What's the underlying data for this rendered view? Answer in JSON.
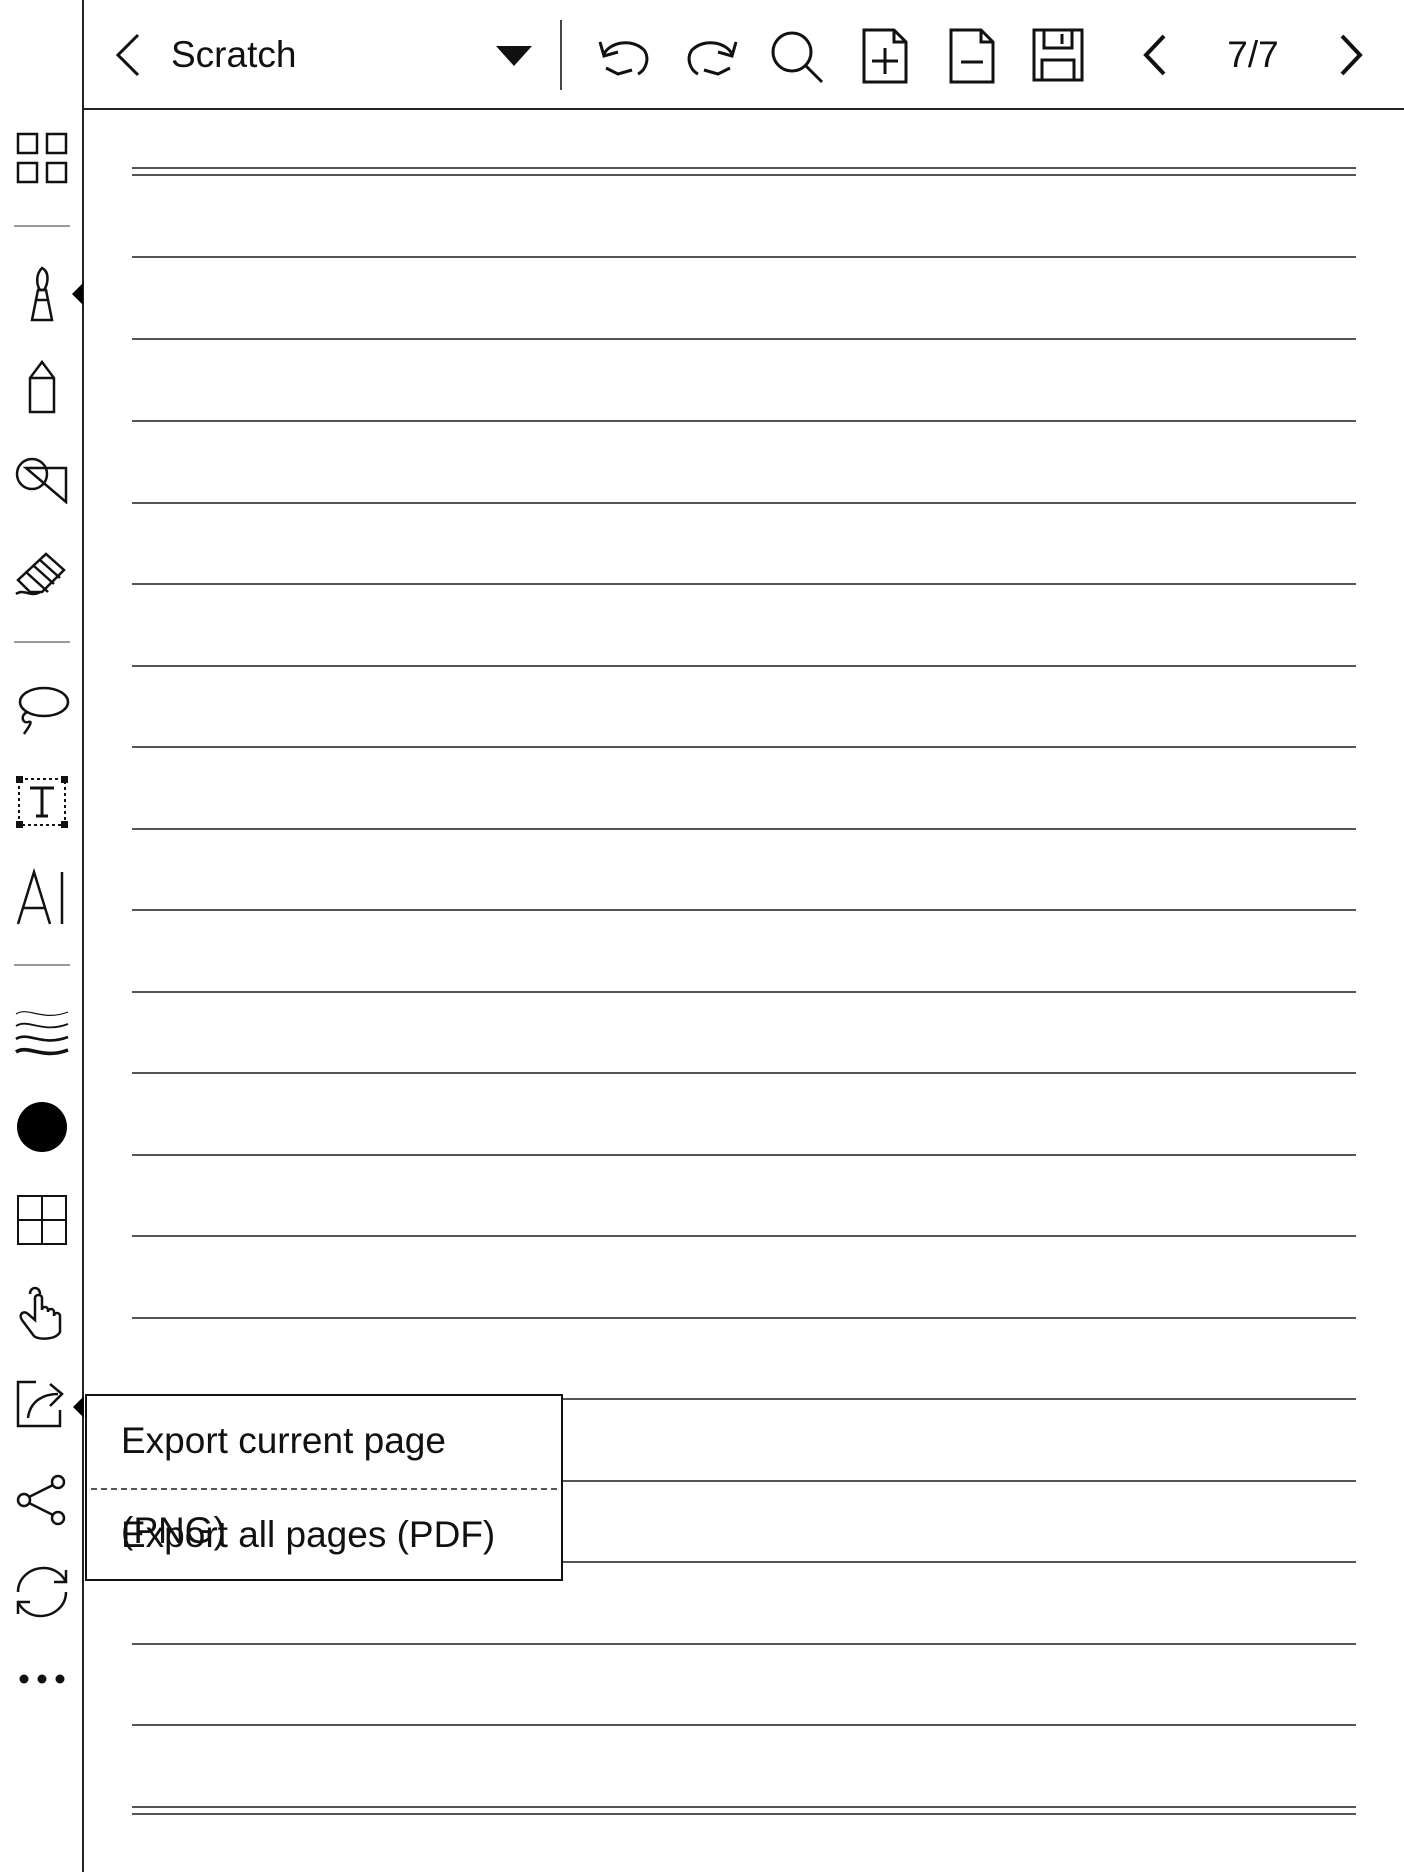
{
  "notebook": {
    "title": "Scratch",
    "page_indicator": "7/7"
  },
  "toolbar": {
    "icons": [
      "fullscreen-icon",
      "back-icon",
      "dropdown-icon",
      "undo-icon",
      "redo-icon",
      "search-icon",
      "add-page-icon",
      "delete-page-icon",
      "save-icon",
      "prev-page-icon",
      "next-page-icon"
    ]
  },
  "sidebar": {
    "icons": [
      "grid-icon",
      "brush-icon",
      "marker-icon",
      "shape-icon",
      "eraser-icon",
      "lasso-icon",
      "textbox-icon",
      "ai-text-icon",
      "stroke-width-icon",
      "color-black-icon",
      "template-icon",
      "touch-icon",
      "export-icon",
      "share-icon",
      "sync-icon",
      "more-icon"
    ],
    "selected_color": "#000000"
  },
  "export_menu": {
    "items": [
      {
        "label": "Export current page (PNG)"
      },
      {
        "label": "Export all pages (PDF)"
      }
    ]
  }
}
